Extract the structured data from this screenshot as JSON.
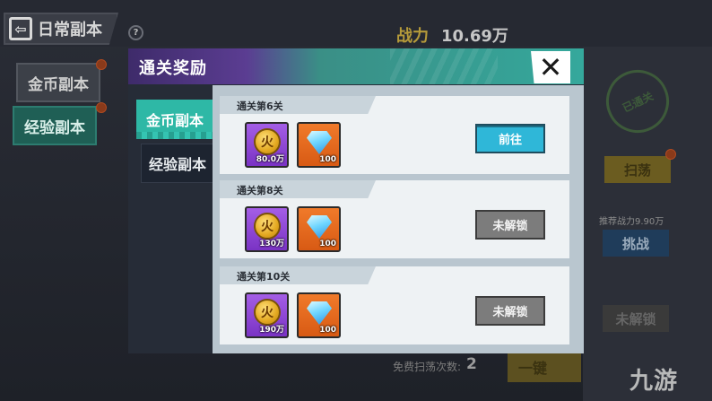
{
  "background": {
    "back_button_label": "日常副本",
    "help_icon": "?",
    "power_label": "战力",
    "power_value": "10.69万",
    "side_tabs": [
      "金币副本",
      "经验副本"
    ],
    "stamp_text": "已通关",
    "sweep_label": "扫荡",
    "recommended_power": "推荐战力9.90万",
    "challenge_label": "挑战",
    "locked_label": "未解锁",
    "free_sweep_label": "免费扫荡次数:",
    "free_sweep_count": "2",
    "one_key_label": "一键",
    "watermark": "九游"
  },
  "dialog": {
    "title": "通关奖励",
    "close_icon": "close-icon",
    "tabs": [
      {
        "label": "金币副本",
        "active": true
      },
      {
        "label": "经验副本",
        "active": false
      }
    ],
    "rewards": [
      {
        "stage": "通关第6关",
        "items": [
          {
            "icon": "gold-coin-icon",
            "coin_glyph": "火",
            "amount": "80.0万"
          },
          {
            "icon": "diamond-icon",
            "amount": "100"
          }
        ],
        "action": "前往",
        "action_state": "active"
      },
      {
        "stage": "通关第8关",
        "items": [
          {
            "icon": "gold-coin-icon",
            "coin_glyph": "火",
            "amount": "130万"
          },
          {
            "icon": "diamond-icon",
            "amount": "100"
          }
        ],
        "action": "未解锁",
        "action_state": "locked"
      },
      {
        "stage": "通关第10关",
        "items": [
          {
            "icon": "gold-coin-icon",
            "coin_glyph": "火",
            "amount": "190万"
          },
          {
            "icon": "diamond-icon",
            "amount": "100"
          }
        ],
        "action": "未解锁",
        "action_state": "locked"
      }
    ]
  },
  "colors": {
    "accent_teal": "#2eb8a6",
    "header_purple": "#5b3d92",
    "go_button": "#2fb7d8",
    "locked_button": "#7c7c7c"
  }
}
